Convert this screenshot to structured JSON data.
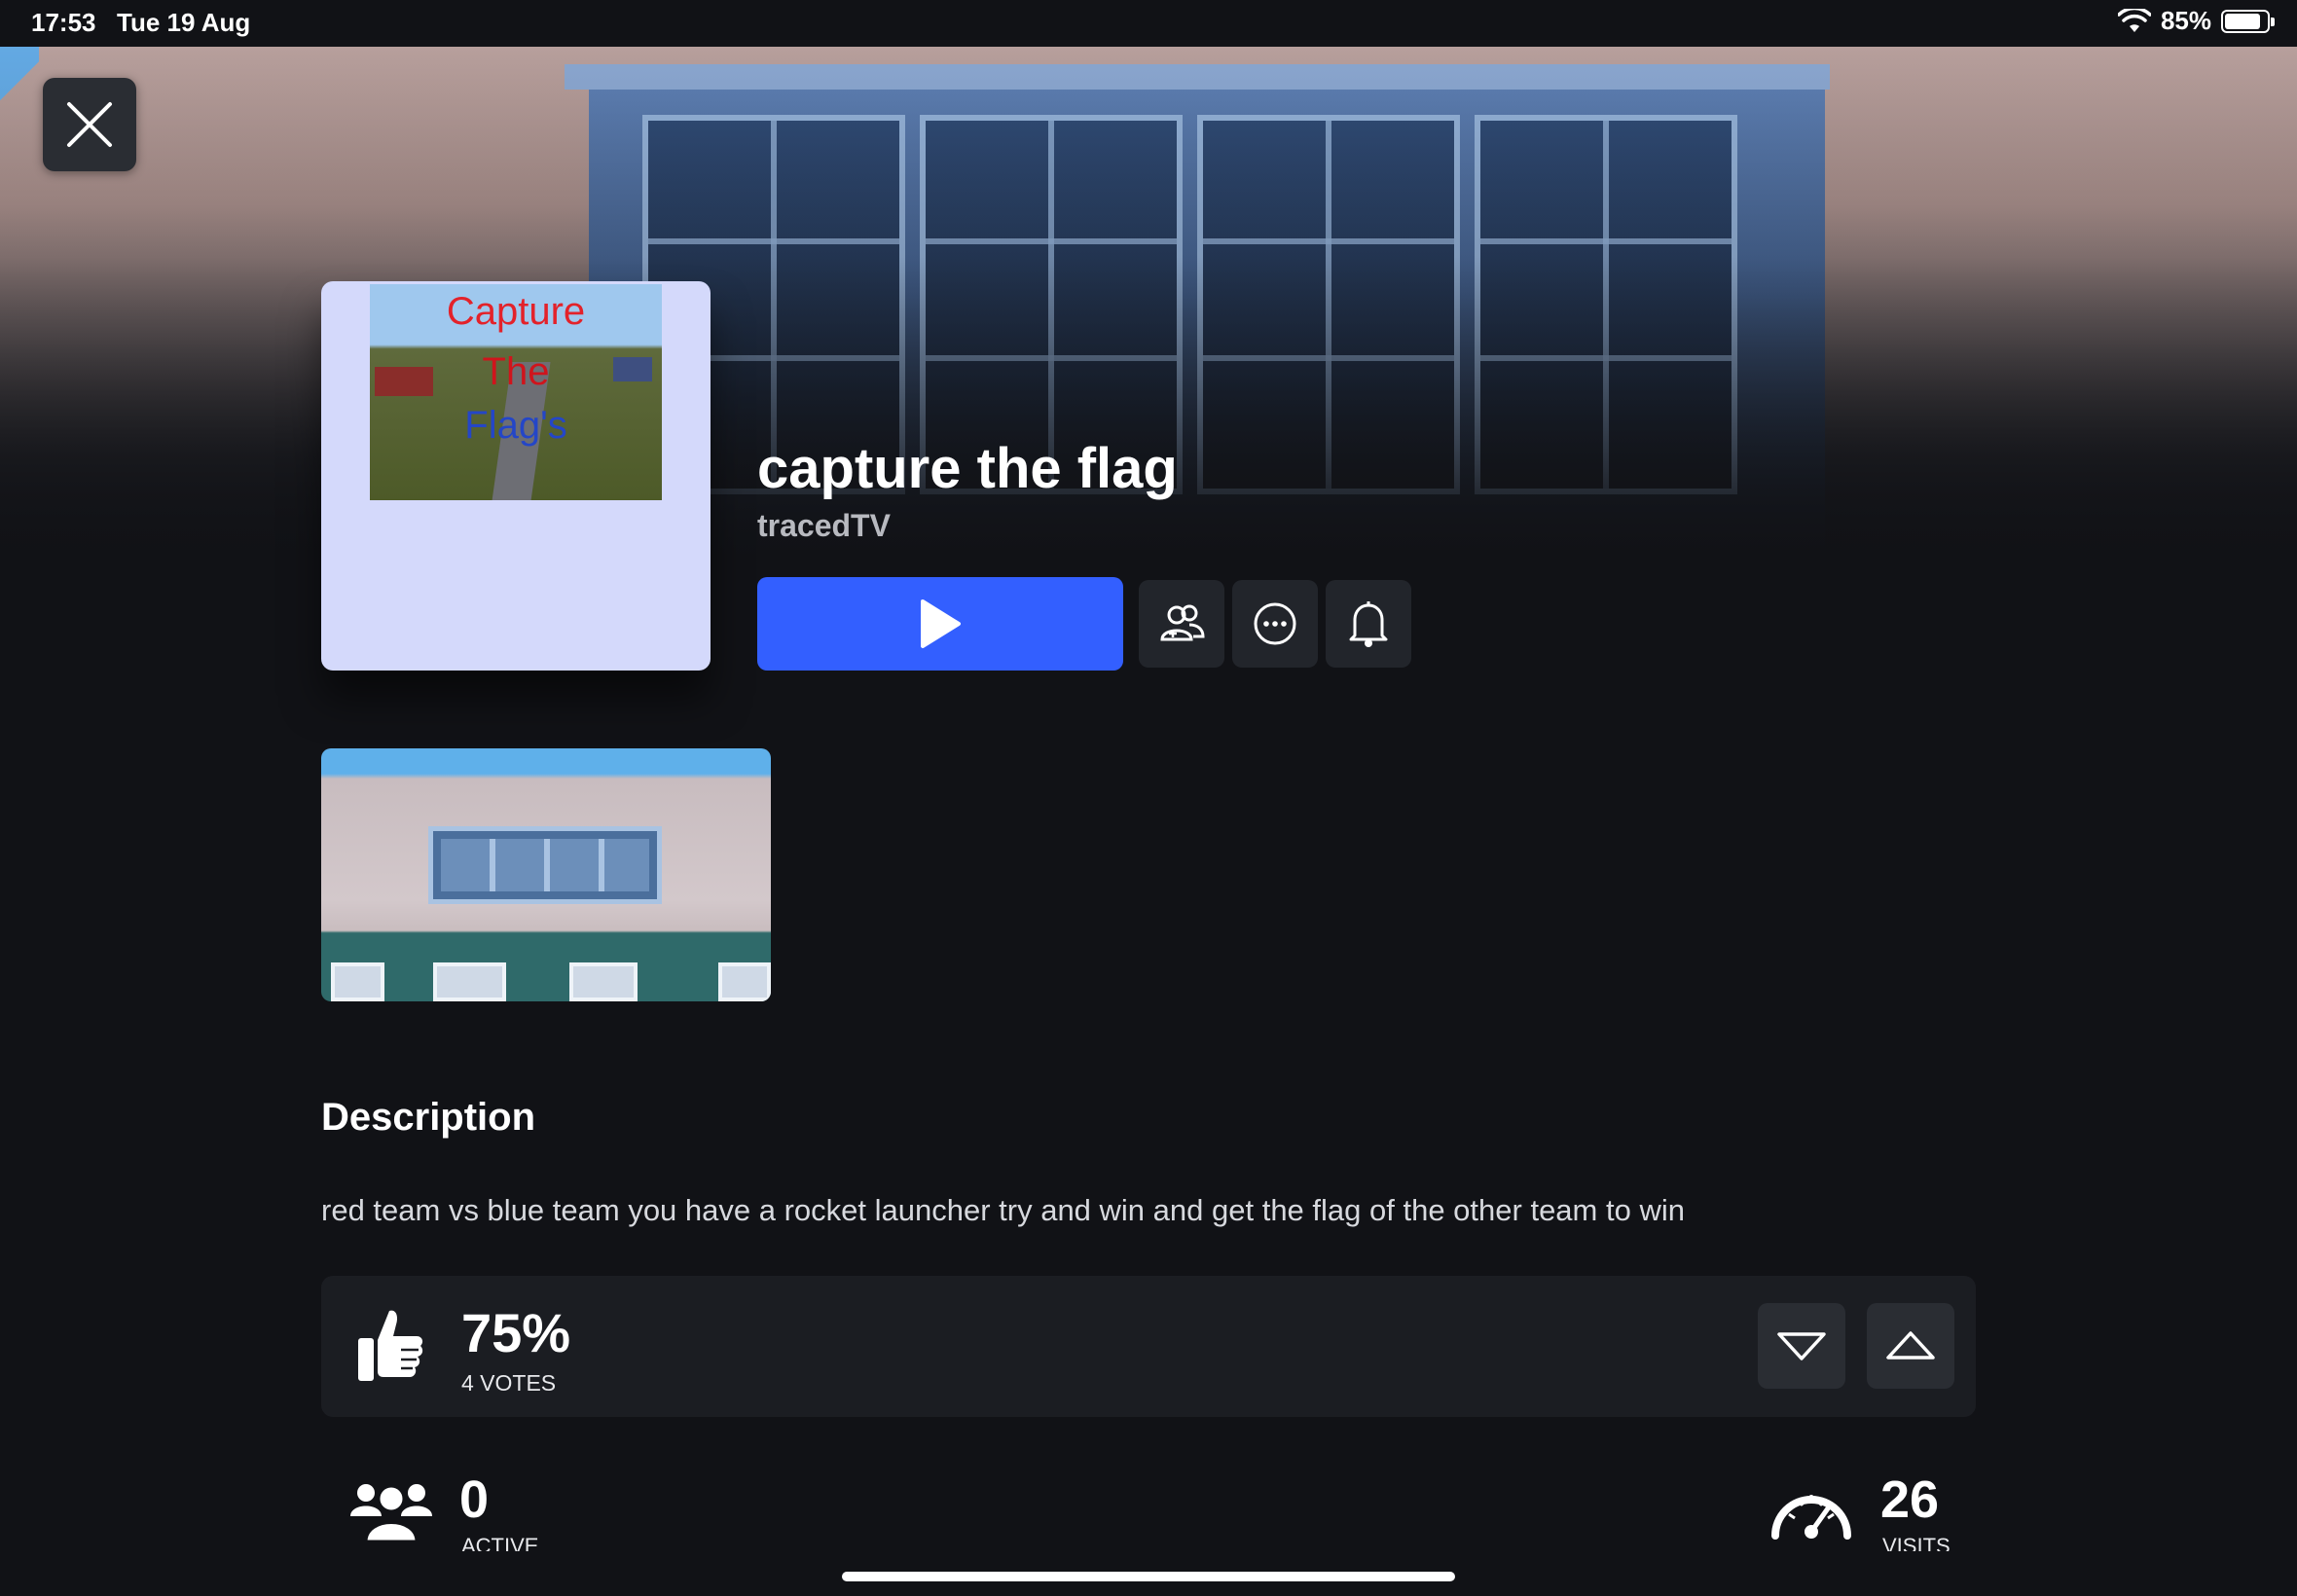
{
  "status_bar": {
    "time": "17:53",
    "date": "Tue 19 Aug",
    "battery": "85%",
    "battery_level": 0.85
  },
  "game": {
    "title": "capture the flag",
    "creator": "tracedTV",
    "icon_text": [
      "Capture",
      "The",
      "Flag's"
    ]
  },
  "description": {
    "heading": "Description",
    "text": "red team vs blue team you have a rocket launcher try and win and get the flag of the other team to win"
  },
  "votes": {
    "percent": "75%",
    "count": "4 VOTES"
  },
  "stats": {
    "active": {
      "value": "0",
      "label": "ACTIVE"
    },
    "visits": {
      "value": "26",
      "label": "VISITS"
    }
  },
  "icons": {
    "close": "close-icon",
    "play": "play-icon",
    "party": "party-icon",
    "more": "more-icon",
    "notify": "bell-icon",
    "like": "thumbs-up-icon",
    "dislike": "thumbs-down-icon",
    "upvote": "thumbs-up-outline-icon",
    "active": "people-icon",
    "visits": "speedometer-icon"
  },
  "colors": {
    "accent": "#335FFF",
    "background": "#111216",
    "card": "#1B1D22",
    "icon_bg": "#D4D9FB"
  }
}
